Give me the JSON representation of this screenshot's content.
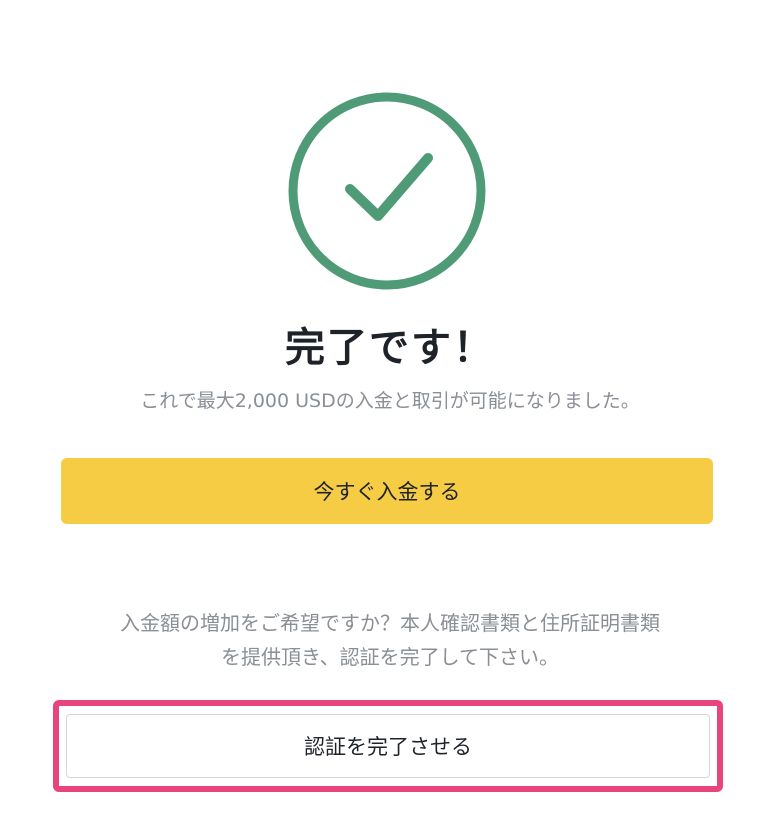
{
  "icon": {
    "name": "checkmark-circle-icon",
    "color": "#4f9b77"
  },
  "heading": "完了です！",
  "subtitle": "これで最大2,000 USDの入金と取引が可能になりました。",
  "deposit_button": {
    "label": "今すぐ入金する",
    "color": "#f7cc45"
  },
  "info": {
    "line1": "入金額の増加をご希望ですか？本人確認書類と住所証明書類",
    "line2": "を提供頂き、認証を完了して下さい。"
  },
  "verify_button": {
    "label": "認証を完了させる",
    "highlight_color": "#e8467a"
  }
}
